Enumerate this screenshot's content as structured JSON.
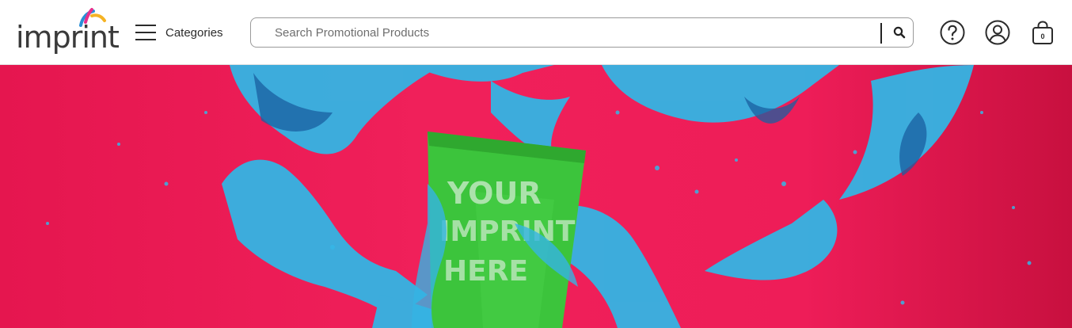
{
  "header": {
    "logo_text": "imprint",
    "categories_label": "Categories",
    "search": {
      "placeholder": "Search Promotional Products",
      "value": ""
    },
    "cart_count": "0"
  },
  "hero": {
    "cup_print_lines": [
      "YOUR",
      "IMPRINT",
      "HERE"
    ]
  },
  "icons": {
    "menu": "hamburger-icon",
    "search": "magnifier-icon",
    "help": "question-circle-icon",
    "account": "user-circle-icon",
    "cart": "shopping-bag-icon"
  },
  "colors": {
    "hero_background": "#ee1d58",
    "splash": "#35b6e6",
    "cup": "#3cc43c",
    "logo_marks": [
      "#e8308c",
      "#2a8fd6",
      "#f5b323"
    ]
  }
}
